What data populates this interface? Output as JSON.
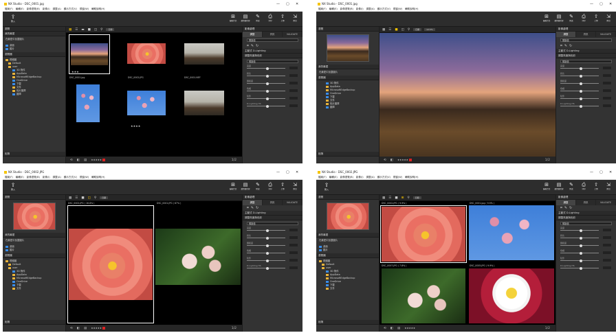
{
  "app": {
    "title_1": "NX Studio - DSC_0001.jpg",
    "title_3": "NX Studio - DSC_0002.JPG",
    "window_controls": [
      "—",
      "▢",
      "✕"
    ],
    "menu": [
      "檔案(F)",
      "編輯(E)",
      "影像瀏覽(B)",
      "影像(I)",
      "調整(A)",
      "顯示方式(V)",
      "視窗(W)",
      "輔助說明(H)"
    ],
    "import_label": "匯入",
    "toolbar_right": [
      "編輯方式",
      "瀏覽器管理",
      "修改",
      "列印",
      "上傳",
      "匯出"
    ]
  },
  "left": {
    "browse": "瀏覽",
    "favorites_header": "我的最愛",
    "favorites_item": "在最愛中加載圖片",
    "shortcuts": [
      "桌面",
      "圖片"
    ],
    "folders_header": "瀏覽器",
    "folders": [
      "視頻圖",
      "Default",
      "user",
      "3D 物件",
      "AppData",
      "MicrosoftEdgeBackup",
      "OneDrive",
      "下載",
      "文件",
      "相片圖庫",
      "圖庫"
    ],
    "footer": "相簿"
  },
  "center": {
    "rating_stars": "★★★",
    "rating_stars_2": "★★★★",
    "captions_1": [
      "DSC_0001.jpg",
      "DSC_0002.JPG",
      "DSC_0001.NEF"
    ],
    "captions_3": [
      "DSC_0002.JPG ( 16.8% )",
      "DSC_0001.JPG ( 67% )"
    ],
    "captions_4": [
      "DSC_0002.JPG ( 9.9% )",
      "DSC_0001.jpg ( 9.9% )",
      "DSC_0007.JPG ( 7.8% )",
      "DSC_0005.JPG ( 9.9% )"
    ],
    "zoom_text": "12.5%",
    "sort_label": "日期",
    "page_indicator": "1/2"
  },
  "right": {
    "top_header": "影像處理",
    "tabs": [
      "調整",
      "資訊",
      "VALIDATE"
    ],
    "preset": "預設值",
    "section_1": "主動式 D-Lighting",
    "section_2": "調整亮度與色彩",
    "preset_2": "預設值",
    "sliders": [
      "亮度",
      "對比",
      "飽和度",
      "色相",
      "陰影",
      "D-Lighting HS"
    ]
  }
}
